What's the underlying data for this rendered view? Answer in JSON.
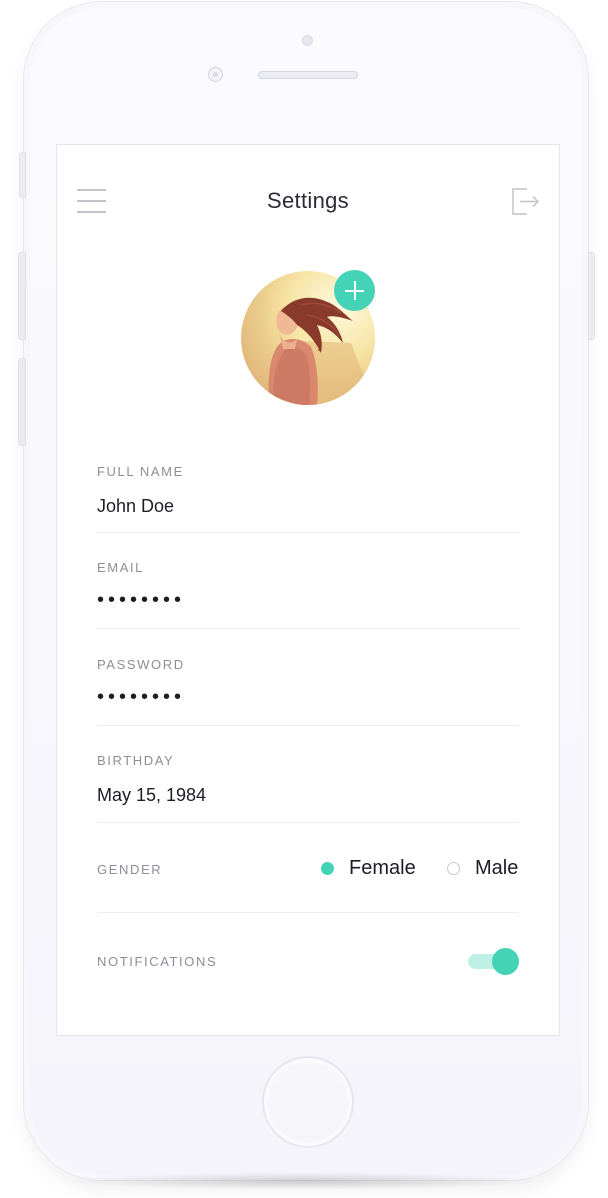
{
  "header": {
    "title": "Settings",
    "menu_icon": "hamburger-menu-icon",
    "logout_icon": "logout-icon"
  },
  "profile": {
    "avatar_alt": "profile photo",
    "add_photo_icon": "plus-icon"
  },
  "form": {
    "full_name": {
      "label": "FULL NAME",
      "value": "John Doe"
    },
    "email": {
      "label": "EMAIL",
      "value": "••••••••"
    },
    "password": {
      "label": "PASSWORD",
      "value": "••••••••"
    },
    "birthday": {
      "label": "BIRTHDAY",
      "value": "May 15, 1984"
    },
    "gender": {
      "label": "GENDER",
      "options": [
        {
          "label": "Female",
          "selected": true
        },
        {
          "label": "Male",
          "selected": false
        }
      ]
    },
    "notifications": {
      "label": "NOTIFICATIONS",
      "enabled": true
    }
  },
  "colors": {
    "accent": "#45d3b7",
    "accent_light": "#bff0e5",
    "label": "#8e8e98",
    "text": "#1d1d26",
    "divider": "#ececf1"
  }
}
